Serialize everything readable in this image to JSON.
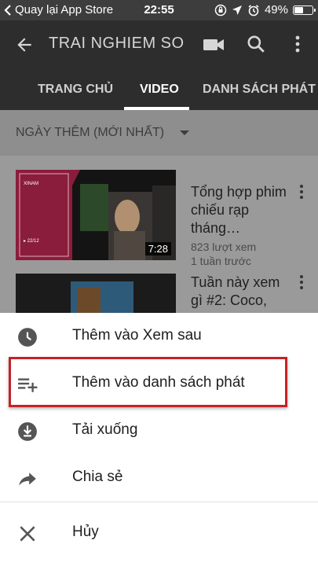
{
  "status_bar": {
    "back_app": "Quay lại App Store",
    "time": "22:55",
    "battery": "49%",
    "icons": [
      "back-arrow-icon",
      "orientation-lock-icon",
      "location-icon",
      "alarm-icon",
      "battery-icon"
    ]
  },
  "app_bar": {
    "title": "TRAI NGHIEM SO",
    "icons": [
      "back-icon",
      "video-camera-icon",
      "search-icon",
      "more-vert-icon"
    ]
  },
  "tabs": [
    {
      "label": "TRANG CHỦ",
      "active": false
    },
    {
      "label": "VIDEO",
      "active": true
    },
    {
      "label": "DANH SÁCH PHÁT",
      "active": false
    }
  ],
  "filter": {
    "label": "NGÀY THÊM (MỚI NHẤT)"
  },
  "videos": [
    {
      "title": "Tổng hợp phim chiếu rạp tháng…",
      "views": "823 lượt xem",
      "age": "1 tuần trước",
      "duration": "7:28",
      "thumb_text": "XINAM",
      "thumb_badge": "▸ 22/12"
    },
    {
      "title": "Tuần này xem gì #2: Coco,",
      "views": "",
      "age": "",
      "duration": ""
    }
  ],
  "sheet": {
    "options": [
      {
        "label": "Thêm vào Xem sau",
        "icon": "clock-icon"
      },
      {
        "label": "Thêm vào danh sách phát",
        "icon": "playlist-add-icon",
        "highlighted": true
      },
      {
        "label": "Tải xuống",
        "icon": "download-icon"
      },
      {
        "label": "Chia sẻ",
        "icon": "share-icon"
      },
      {
        "label": "Hủy",
        "icon": "close-icon"
      }
    ]
  },
  "colors": {
    "app_bar": "#2d2d2d",
    "highlight": "#c62127",
    "sheet": "#ffffff"
  }
}
